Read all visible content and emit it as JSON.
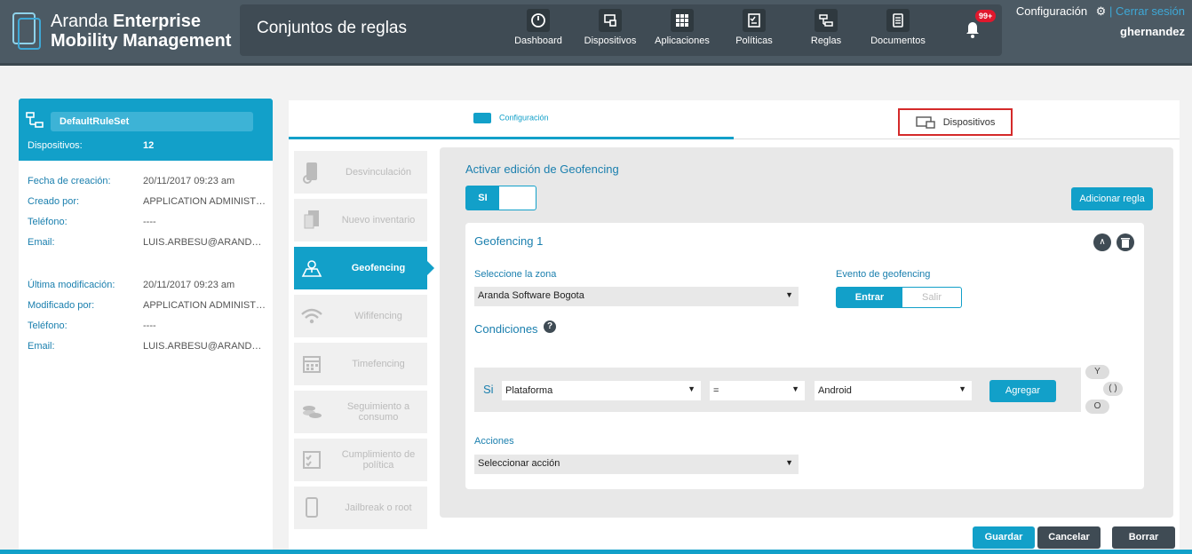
{
  "header": {
    "brand_line1_regular": "Aranda",
    "brand_line1_bold": "Enterprise",
    "brand_line2": "Mobility Management",
    "page_title": "Conjuntos de reglas",
    "nav": [
      {
        "label": "Dashboard",
        "icon": "dashboard-gauge-icon"
      },
      {
        "label": "Dispositivos",
        "icon": "devices-icon"
      },
      {
        "label": "Aplicaciones",
        "icon": "apps-grid-icon"
      },
      {
        "label": "Políticas",
        "icon": "policy-checklist-icon"
      },
      {
        "label": "Reglas",
        "icon": "rules-icon"
      },
      {
        "label": "Documentos",
        "icon": "documents-icon"
      }
    ],
    "notifications_badge": "99+",
    "config_label": "Configuración",
    "logout_label": "Cerrar sesión",
    "separator": "|",
    "username": "ghernandez"
  },
  "ruleset": {
    "name": "DefaultRuleSet",
    "devices_label": "Dispositivos:",
    "devices_count": "12",
    "created": [
      {
        "label": "Fecha de creación:",
        "value": "20/11/2017 09:23 am"
      },
      {
        "label": "Creado por:",
        "value": "APPLICATION ADMINISTRATOR"
      },
      {
        "label": "Teléfono:",
        "value": "----"
      },
      {
        "label": "Email:",
        "value": "LUIS.ARBESU@ARANDASOFT.COM"
      }
    ],
    "modified": [
      {
        "label": "Última modificación:",
        "value": "20/11/2017 09:23 am"
      },
      {
        "label": "Modificado por:",
        "value": "APPLICATION ADMINISTRATOR"
      },
      {
        "label": "Teléfono:",
        "value": "----"
      },
      {
        "label": "Email:",
        "value": "LUIS.ARBESU@ARANDASOFT.COM"
      }
    ]
  },
  "tabs": {
    "config_label": "Configuración",
    "devices_label": "Dispositivos"
  },
  "side_menu": [
    {
      "label": "Desvinculación",
      "icon": "unlink-phone-icon",
      "active": false
    },
    {
      "label": "Nuevo inventario",
      "icon": "inventory-icon",
      "active": false
    },
    {
      "label": "Geofencing",
      "icon": "map-pin-icon",
      "active": true
    },
    {
      "label": "Wififencing",
      "icon": "wifi-icon",
      "active": false
    },
    {
      "label": "Timefencing",
      "icon": "calendar-icon",
      "active": false
    },
    {
      "label": "Seguimiento a consumo",
      "icon": "coins-icon",
      "active": false
    },
    {
      "label": "Cumplimiento de política",
      "icon": "checklist-icon",
      "active": false
    },
    {
      "label": "Jailbreak o root",
      "icon": "phone-lock-icon",
      "active": false
    }
  ],
  "geofencing": {
    "activate_label": "Activar edición de Geofencing",
    "toggle_value": "SI",
    "add_rule_label": "Adicionar regla",
    "card_title": "Geofencing 1",
    "collapse_glyph": "∧",
    "zone_label": "Seleccione la zona",
    "zone_value": "Aranda Software Bogota",
    "event_label": "Evento de geofencing",
    "event_enter": "Entrar",
    "event_exit": "Salir",
    "conditions_label": "Condiciones",
    "help_glyph": "?",
    "condition": {
      "prefix": "Si",
      "field": "Plataforma",
      "operator": "=",
      "value": "Android",
      "add_label": "Agregar"
    },
    "logic_and": "Y",
    "logic_paren": "( )",
    "logic_or": "O",
    "actions_label": "Acciones",
    "actions_value": "Seleccionar acción"
  },
  "footer": {
    "save_label": "Guardar",
    "cancel_label": "Cancelar",
    "delete_label": "Borrar"
  },
  "colors": {
    "accent": "#12a0c9",
    "header": "#4c5a64",
    "highlight_border": "#d42a2a",
    "badge": "#e0182d"
  }
}
